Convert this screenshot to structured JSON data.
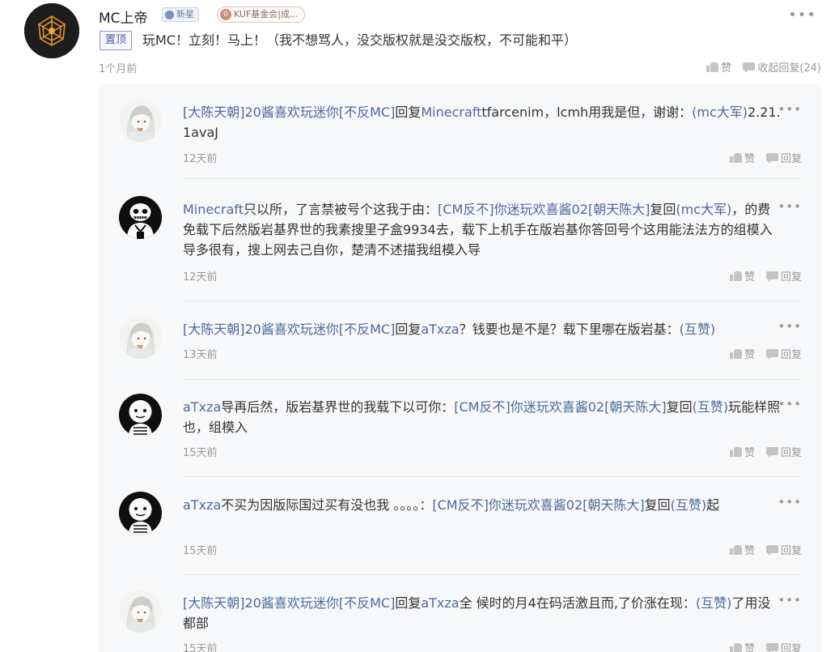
{
  "post": {
    "author": "MC上帝",
    "badge_new": "新星",
    "badge_fan_num": "0",
    "badge_fan": "KUF基金会|成...",
    "pin_tag": "置顶",
    "text": "玩MC！立刻！马上！（我不想骂人，没交版权就是没交版权，不可能和平）",
    "time": "1个月前",
    "like_label": "赞",
    "collapse_label": "收起回复(24)",
    "more": "•••"
  },
  "replies": [
    {
      "avatar": "anime-girl",
      "parts": [
        {
          "t": "[大陈天朝]20酱喜欢玩迷你[不反MC]",
          "u": true
        },
        {
          "t": "回复",
          "u": false
        },
        {
          "t": "Minecraft",
          "u": true
        },
        {
          "t": "tfarcenim，lcmh用我是但，谢谢：",
          "u": false
        },
        {
          "t": "(mc大军)",
          "u": true
        },
        {
          "t": "2.21.1avaJ",
          "u": false
        }
      ],
      "time": "12天前",
      "like": "赞",
      "reply": "回复"
    },
    {
      "avatar": "skeleton",
      "parts": [
        {
          "t": "Minecraft",
          "u": true
        },
        {
          "t": "只以所，了言禁被号个这我于由：",
          "u": false
        },
        {
          "t": "[CM反不]你迷玩欢喜酱02[朝天陈大]",
          "u": true
        },
        {
          "t": "复回",
          "u": false
        },
        {
          "t": "(mc大军)",
          "u": true
        },
        {
          "t": "，的费免载下后然版岩基界世的我素搜里子盒9934去，载下上机手在版岩基你答回号个这用能法法方的组模入导多很有，搜上网去己自你，楚清不述描我组模入导",
          "u": false
        }
      ],
      "time": "12天前",
      "like": "赞",
      "reply": "回复"
    },
    {
      "avatar": "anime-girl",
      "parts": [
        {
          "t": "[大陈天朝]20酱喜欢玩迷你[不反MC]",
          "u": true
        },
        {
          "t": "回复",
          "u": false
        },
        {
          "t": "aTxza",
          "u": true
        },
        {
          "t": "？钱要也是不是？载下里哪在版岩基：",
          "u": false
        },
        {
          "t": "(互赞)",
          "u": true
        }
      ],
      "time": "13天前",
      "like": "赞",
      "reply": "回复"
    },
    {
      "avatar": "round-face",
      "parts": [
        {
          "t": "aTxza",
          "u": true
        },
        {
          "t": "导再后然，版岩基界世的我载下以可你：",
          "u": false
        },
        {
          "t": "[CM反不]你迷玩欢喜酱02[朝天陈大]",
          "u": true
        },
        {
          "t": "复回",
          "u": false
        },
        {
          "t": "(互赞)",
          "u": true
        },
        {
          "t": "玩能样照也，组模入",
          "u": false
        }
      ],
      "time": "15天前",
      "like": "赞",
      "reply": "回复"
    },
    {
      "avatar": "round-face",
      "parts": [
        {
          "t": "aTxza",
          "u": true
        },
        {
          "t": "不买为因版际国过买有没也我 。。。。：",
          "u": false
        },
        {
          "t": "[CM反不]你迷玩欢喜酱02[朝天陈大]",
          "u": true
        },
        {
          "t": "复回",
          "u": false
        },
        {
          "t": "(互赞)",
          "u": true
        },
        {
          "t": "起",
          "u": false
        }
      ],
      "time": "15天前",
      "like": "赞",
      "reply": "回复"
    },
    {
      "avatar": "anime-girl",
      "parts": [
        {
          "t": "[大陈天朝]20酱喜欢玩迷你[不反MC]",
          "u": true
        },
        {
          "t": "回复",
          "u": false
        },
        {
          "t": "aTxza",
          "u": true
        },
        {
          "t": "全 候时的月4在码活激且而,了价涨在现：",
          "u": false
        },
        {
          "t": "(互赞)",
          "u": true
        },
        {
          "t": "了用没都部",
          "u": false
        }
      ],
      "time": "15天前",
      "like": "赞",
      "reply": "回复"
    }
  ]
}
